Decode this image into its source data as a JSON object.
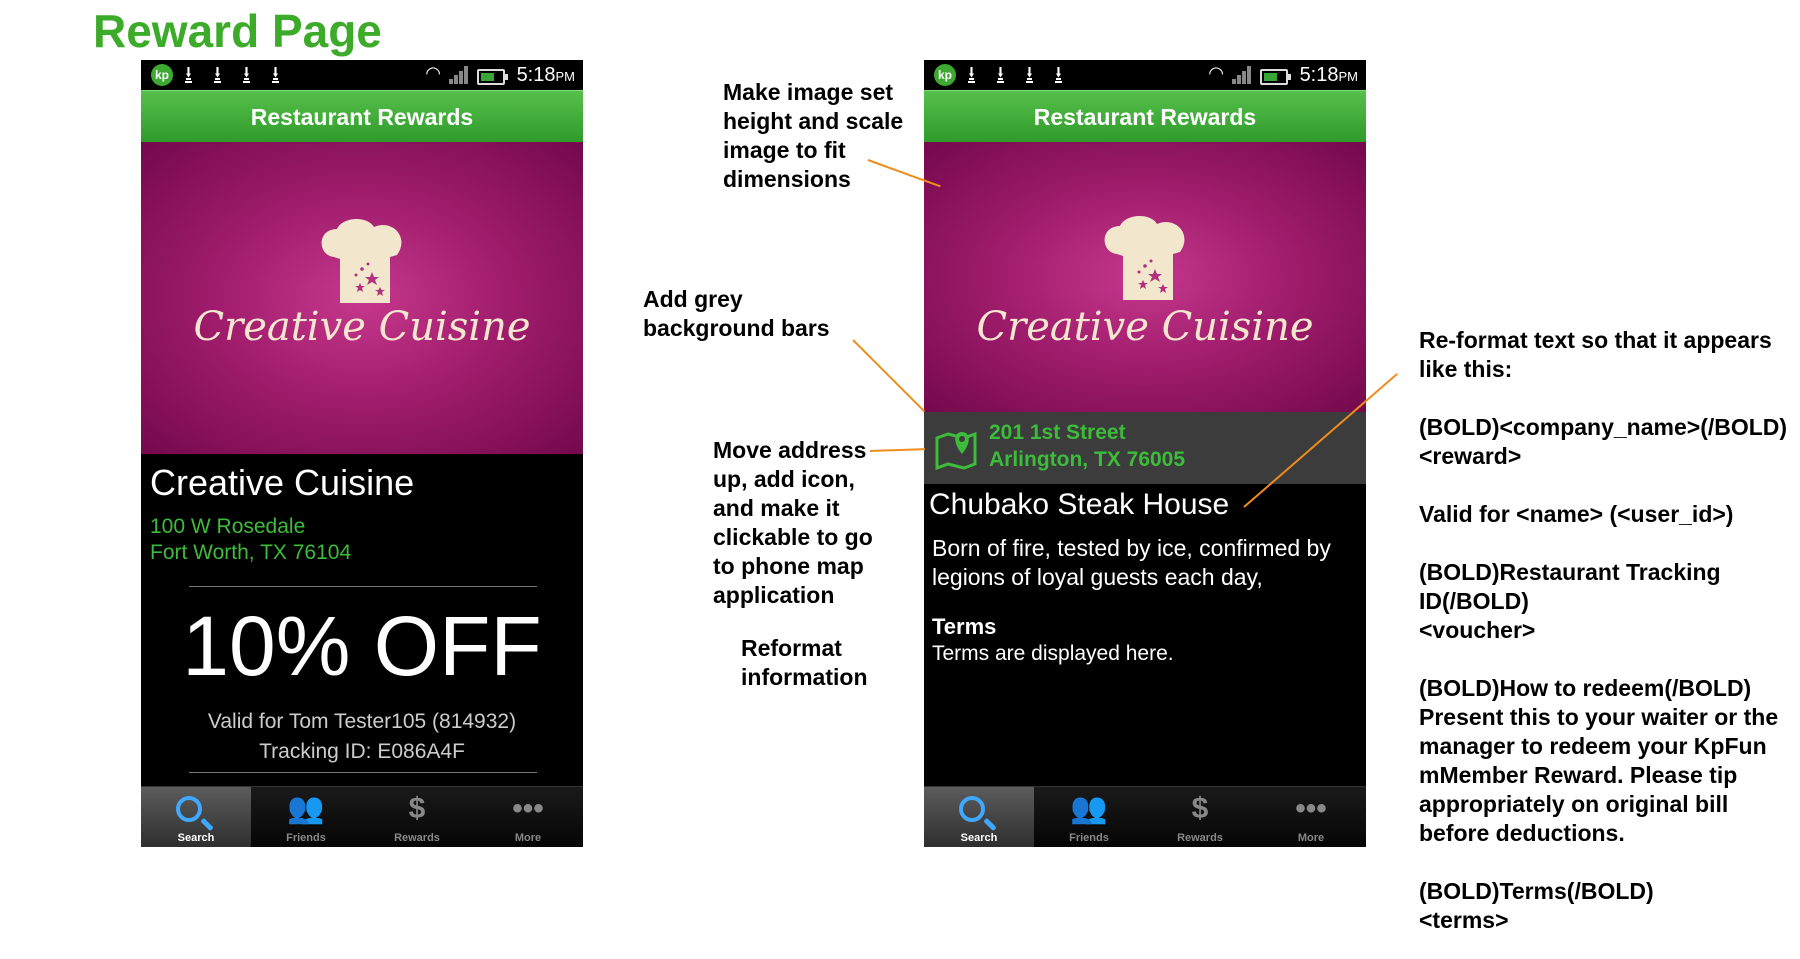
{
  "page_title": "Reward Page",
  "status_bar": {
    "time": "5:18",
    "ampm": "PM"
  },
  "app_bar_title": "Restaurant Rewards",
  "hero_name": "Creative Cuisine",
  "phone_left": {
    "restaurant_name": "Creative Cuisine",
    "address_line1": "100 W Rosedale",
    "address_line2": "Fort Worth, TX 76104",
    "offer": "10% OFF",
    "valid_for": "Valid for Tom Tester105 (814932)",
    "tracking": "Tracking ID: E086A4F"
  },
  "phone_right": {
    "address_line1": "201 1st Street",
    "address_line2": "Arlington, TX 76005",
    "restaurant_name": "Chubako Steak House",
    "description": "Born of fire, tested by ice, confirmed by legions of loyal guests each day,",
    "terms_label": "Terms",
    "terms_text": "Terms are displayed here."
  },
  "tabs": [
    "Search",
    "Friends",
    "Rewards",
    "More"
  ],
  "notes": {
    "image": [
      "Make image set",
      "height and scale",
      "image to fit",
      "dimensions"
    ],
    "grey": [
      "Add grey",
      "background bars"
    ],
    "address": [
      "Move address",
      "up, add icon,",
      "and make it",
      "clickable to go",
      "to phone map",
      "application"
    ],
    "reformat": [
      "Reformat",
      "information"
    ],
    "format_lines": [
      "Re-format text so that it appears",
      "like this:",
      "",
      "(BOLD)<company_name>(/BOLD)",
      "<reward>",
      "",
      "Valid for <name> (<user_id>)",
      "",
      "(BOLD)Restaurant Tracking",
      "ID(/BOLD)",
      "<voucher>",
      "",
      "(BOLD)How to redeem(/BOLD)",
      "Present this to your waiter or the",
      "manager to redeem your KpFun",
      "mMember Reward. Please tip",
      "appropriately on original bill",
      "before deductions.",
      "",
      "(BOLD)Terms(/BOLD)",
      "<terms>"
    ]
  },
  "colors": {
    "accent_green": "#3cab2a",
    "app_bar_green": "#3fab36",
    "hero_magenta": "#a11d6d",
    "address_green": "#3dbb3a",
    "grey_bar": "#3c3c3c",
    "annotation_line": "#f08c1b",
    "tab_active_blue": "#3fa8ff"
  },
  "icons": [
    "app-logo-icon",
    "download-icon",
    "wifi-icon",
    "signal-icon",
    "battery-icon",
    "chef-hat-icon",
    "map-pin-icon",
    "search-icon",
    "friends-icon",
    "dollar-icon",
    "more-icon"
  ]
}
